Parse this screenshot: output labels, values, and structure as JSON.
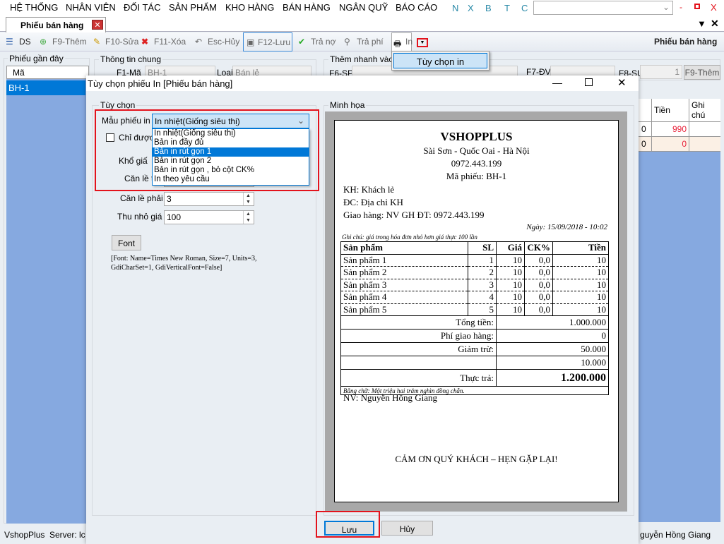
{
  "menu": {
    "items": [
      "HỆ THỐNG",
      "NHÂN VIÊN",
      "ĐỐI TÁC",
      "SẢN PHẨM",
      "KHO HÀNG",
      "BÁN HÀNG",
      "NGÂN QUỸ",
      "BÁO CÁO"
    ],
    "shortcuts": [
      "N",
      "X",
      "B",
      "T",
      "C"
    ],
    "search_value": "",
    "min": "-",
    "max": "▫",
    "close": "X"
  },
  "tab": {
    "label": "Phiếu bán hàng"
  },
  "toolbar": {
    "ds": "DS",
    "add": "F9-Thêm",
    "edit": "F10-Sửa",
    "delete": "F11-Xóa",
    "cancel": "Esc-Hủy",
    "save": "F12-Lưu",
    "pay_debt": "Trả nợ",
    "pay_fee": "Trả phí",
    "print": "In",
    "title": "Phiếu bán hàng"
  },
  "print_menu": {
    "item": "Tùy chọn in"
  },
  "recent": {
    "label": "Phiếu gần đây",
    "header": "Mã",
    "rows": [
      "BH-1"
    ]
  },
  "general": {
    "label": "Thông tin chung",
    "code_label": "F1-Mã",
    "code_value": "BH-1",
    "type_label": "Loại",
    "type_value": "Bán lẻ"
  },
  "quick_add": {
    "label": "Thêm nhanh vào m",
    "sp_label": "F6-SP",
    "dv_label": "F7-ĐV",
    "sl_label": "F8-SL",
    "sl_value": "1",
    "add_button": "F9-Thêm"
  },
  "grid": {
    "headers": [
      "Tiền",
      "Ghi chú"
    ],
    "rows": [
      {
        "sl": "0",
        "tien": "990"
      },
      {
        "sl": "0",
        "tien": "0"
      }
    ],
    "amount_color": "#e8243c"
  },
  "dialog": {
    "title": "Tùy chọn phiếu In [Phiếu bán hàng]",
    "options_label": "Tùy chọn",
    "template_label": "Mẫu phiếu in",
    "template_value": "In nhiệt(Giống siêu thị)",
    "template_options": [
      "In nhiệt(Giống siêu thị)",
      "Bản in đầy đủ",
      "Bản in rút gọn 1",
      "Bản in rút gọn 2",
      "Bản in rút gọn , bỏ cột CK%",
      "In theo yêu cầu"
    ],
    "highlighted_option": "Bản in rút gọn 1",
    "checkbox_label": "Chỉ được i",
    "paper_label": "Khổ giấ",
    "margin_top_label": "Căn lề tr",
    "margin_right_label": "Căn lề phải",
    "margin_right_value": "3",
    "scale_label": "Thu nhỏ giá",
    "scale_value": "100",
    "font_button": "Font",
    "font_info": "[Font: Name=Times New Roman, Size=7, Units=3, GdiCharSet=1, GdiVerticalFont=False]",
    "preview_label": "Minh họa",
    "save": "Lưu",
    "cancel": "Hủy"
  },
  "receipt": {
    "shop": "VSHOPPLUS",
    "address": "Sài Sơn - Quốc Oai - Hà Nội",
    "phone": "0972.443.199",
    "code": "Mã phiếu: BH-1",
    "customer": "KH: Khách lẻ",
    "customer_address": "ĐC: Địa chỉ KH",
    "delivery": "Giao hàng: NV GH ĐT: 0972.443.199",
    "date": "Ngày: 15/09/2018 - 10:02",
    "note": "Ghi chú: giá trong hóa đơn nhỏ hơn giá thực 100 lần",
    "headers": [
      "Sản phẩm",
      "SL",
      "Giá",
      "CK%",
      "Tiền"
    ],
    "items": [
      [
        "Sản phẩm 1",
        "1",
        "10",
        "0,0",
        "10"
      ],
      [
        "Sản phẩm 2",
        "2",
        "10",
        "0,0",
        "10"
      ],
      [
        "Sản phẩm 3",
        "3",
        "10",
        "0,0",
        "10"
      ],
      [
        "Sản phẩm 4",
        "4",
        "10",
        "0,0",
        "10"
      ],
      [
        "Sản phẩm 5",
        "5",
        "10",
        "0,0",
        "10"
      ]
    ],
    "totals": [
      [
        "Tổng tiền:",
        "1.000.000"
      ],
      [
        "Phí giao hàng:",
        "0"
      ],
      [
        "Giảm trừ:",
        "50.000"
      ],
      [
        "",
        "10.000"
      ],
      [
        "Thực trả:",
        "1.200.000"
      ]
    ],
    "in_words": "Bằng chữ: Một triệu hai trăm nghìn đồng chẵn.",
    "staff": "NV: Nguyễn Hồng Giang",
    "thanks": "CẢM ƠN QUÝ KHÁCH – HẸN GẶP LẠI!"
  },
  "status": {
    "app": "VshopPlus",
    "server": "Server: lc",
    "user": "guyễn Hồng Giang"
  },
  "colors": {
    "highlight": "#e3131c",
    "selection": "#0078d7",
    "list_bg": "#86a9e0"
  }
}
